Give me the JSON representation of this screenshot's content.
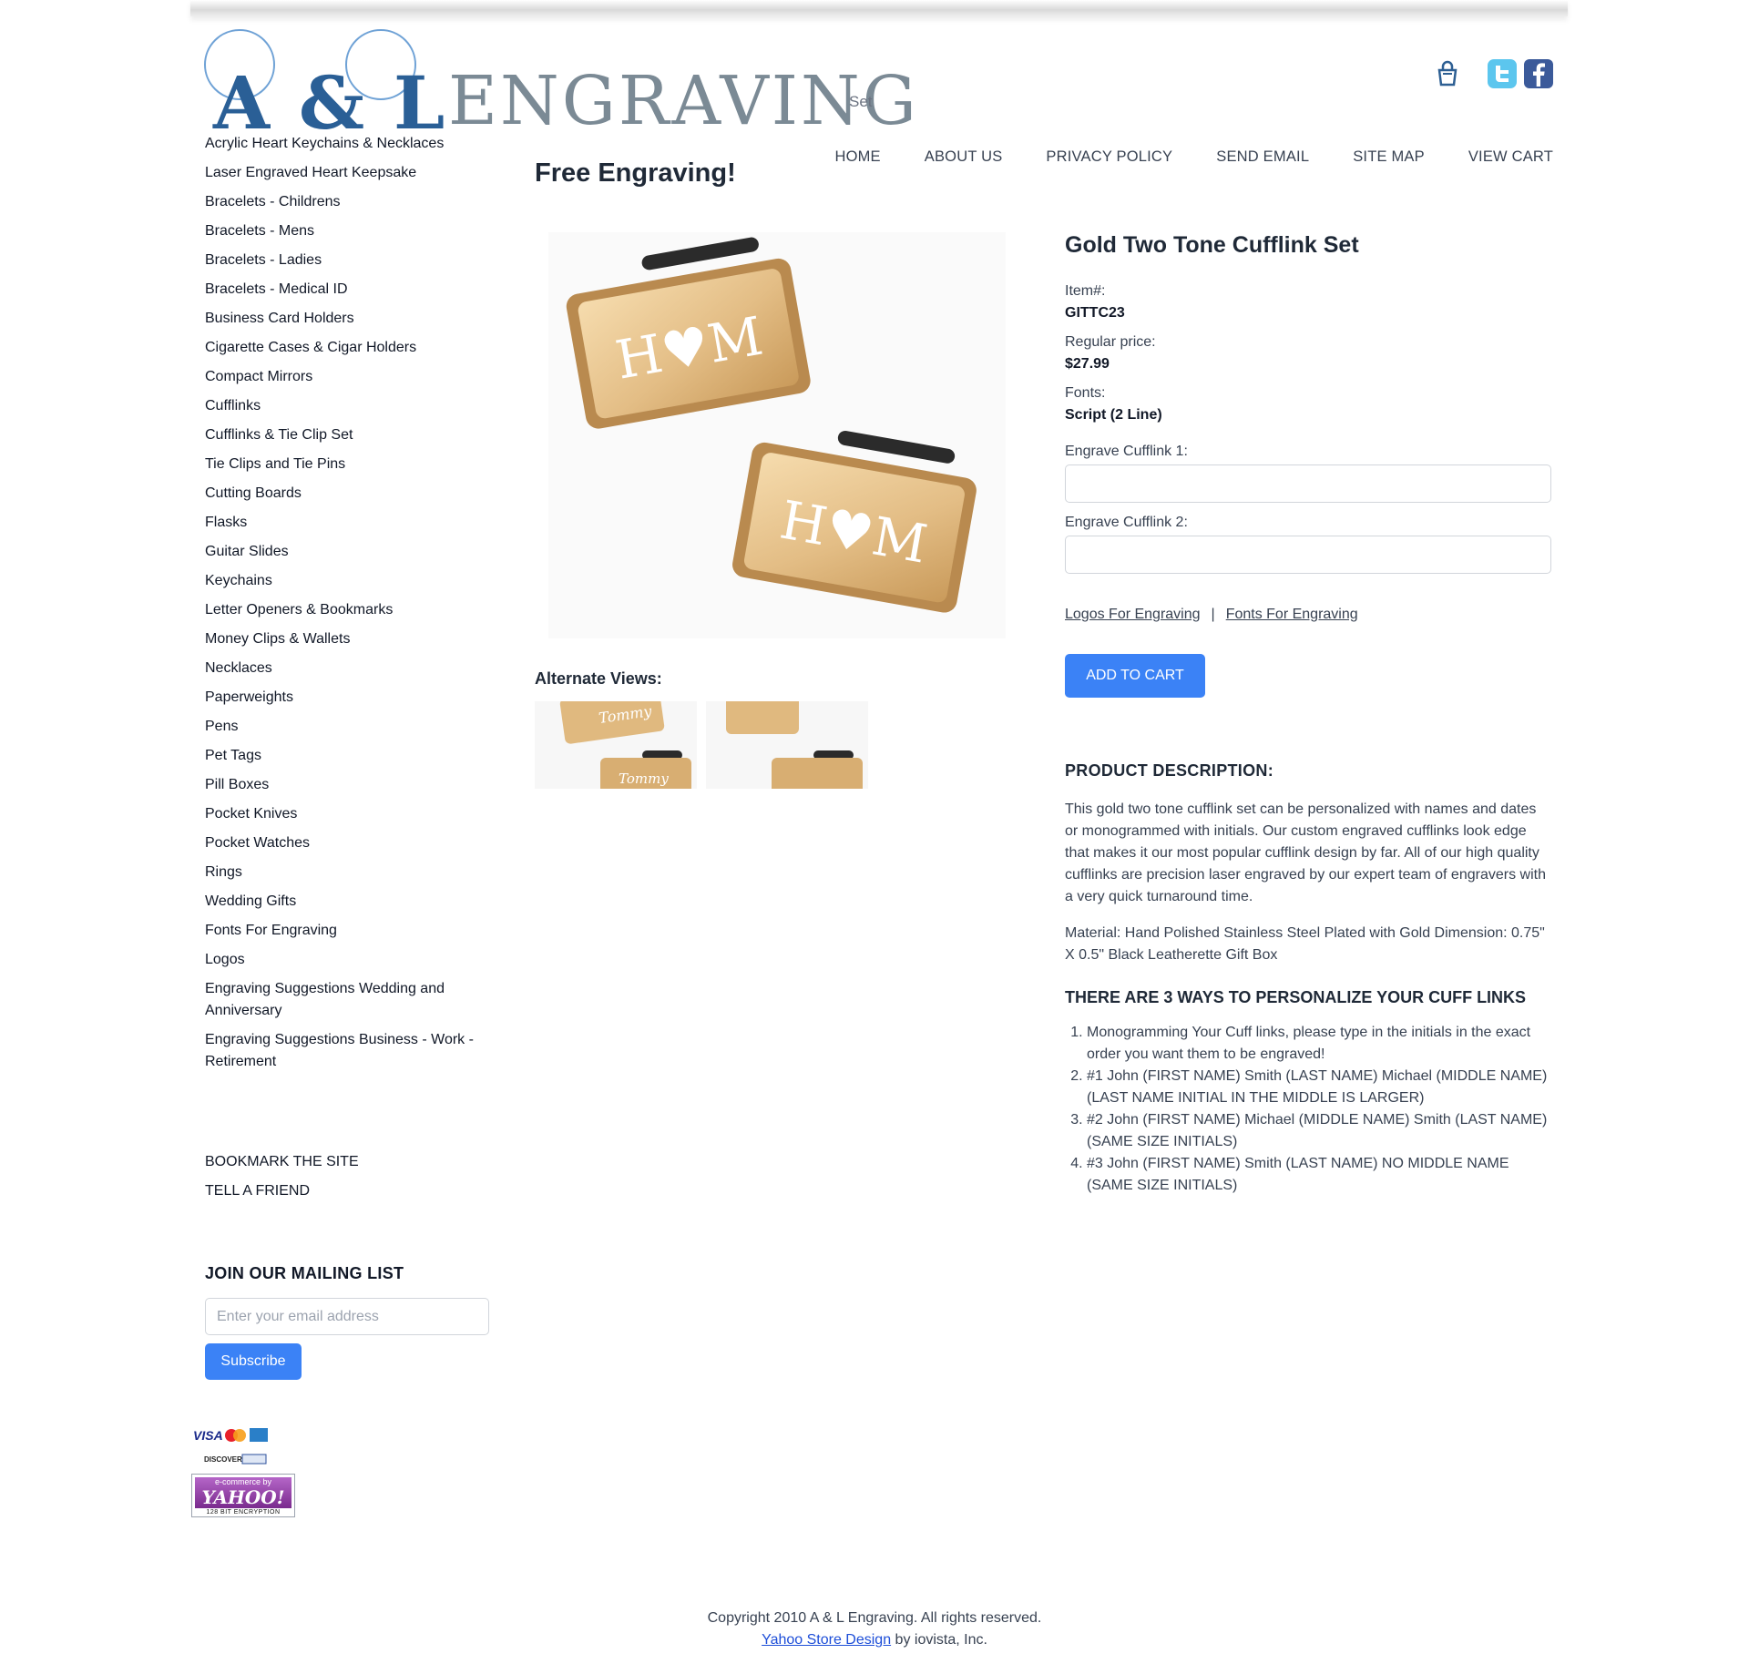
{
  "header": {
    "logo_letters": "A & L",
    "logo_word": "ENGRAVING",
    "logo_tag": "Set",
    "icons": [
      "shopping-bag-icon",
      "twitter-icon",
      "facebook-icon"
    ]
  },
  "nav": [
    "HOME",
    "ABOUT US",
    "PRIVACY POLICY",
    "SEND EMAIL",
    "SITE MAP",
    "VIEW CART"
  ],
  "promo": "Free Engraving!",
  "sidebar": {
    "categories": [
      "Acrylic Heart Keychains & Necklaces",
      "Laser Engraved Heart Keepsake",
      "Bracelets - Childrens",
      "Bracelets - Mens",
      "Bracelets - Ladies",
      "Bracelets - Medical ID",
      "Business Card Holders",
      "Cigarette Cases & Cigar Holders",
      "Compact Mirrors",
      "Cufflinks",
      "Cufflinks & Tie Clip Set",
      "Tie Clips and Tie Pins",
      "Cutting Boards",
      "Flasks",
      "Guitar Slides",
      "Keychains",
      "Letter Openers & Bookmarks",
      "Money Clips & Wallets",
      "Necklaces",
      "Paperweights",
      "Pens",
      "Pet Tags",
      "Pill Boxes",
      "Pocket Knives",
      "Pocket Watches",
      "Rings",
      "Wedding Gifts",
      "Fonts For Engraving",
      "Logos",
      "Engraving Suggestions Wedding and Anniversary",
      "Engraving Suggestions Business - Work - Retirement"
    ],
    "bookmark": "BOOKMARK THE SITE",
    "tell_friend": "TELL A FRIEND",
    "mailing_title": "JOIN OUR MAILING LIST",
    "email_placeholder": "Enter your email address",
    "subscribe": "Subscribe"
  },
  "badges": {
    "cards": [
      "VISA",
      "DISCOVER"
    ],
    "yahoo_top": "e-commerce by",
    "yahoo_name": "YAHOO!",
    "yahoo_bottom": "128 BIT ENCRYPTION"
  },
  "product": {
    "title": "Gold Two Tone Cufflink Set",
    "item_label": "Item#:",
    "item_value": "GITTC23",
    "price_label": "Regular price:",
    "price_value": "$27.99",
    "fonts_label": "Fonts:",
    "fonts_value": "Script (2 Line)",
    "engrave1_label": "Engrave Cufflink 1:",
    "engrave2_label": "Engrave Cufflink 2:",
    "logos_link": "Logos For Engraving",
    "fonts_link": "Fonts For Engraving",
    "separator": "|",
    "add_to_cart": "ADD TO CART",
    "monogram": "H♥M",
    "alt_views_title": "Alternate Views:",
    "thumb_text": "Tommy",
    "description_title": "PRODUCT DESCRIPTION:",
    "description": "This gold two tone cufflink set can be personalized with names and dates or monogrammed with initials. Our custom engraved cufflinks look edge that makes it our most popular cufflink design by far. All of our high quality cufflinks are precision laser engraved by our expert team of engravers with a very quick turnaround time.",
    "material": "Material: Hand Polished Stainless Steel Plated with Gold Dimension: 0.75\" X 0.5\" Black Leatherette Gift Box",
    "ways_title": "THERE ARE 3 WAYS TO PERSONALIZE YOUR CUFF LINKS",
    "ways": [
      "Monogramming Your Cuff links, please type in the initials in the exact order you want them to be engraved!",
      "#1 John (FIRST NAME) Smith (LAST NAME) Michael (MIDDLE NAME) (LAST NAME INITIAL IN THE MIDDLE IS LARGER)",
      "#2 John (FIRST NAME) Michael (MIDDLE NAME) Smith (LAST NAME) (SAME SIZE INITIALS)",
      "#3 John (FIRST NAME) Smith (LAST NAME) NO MIDDLE NAME (SAME SIZE INITIALS)"
    ]
  },
  "footer": {
    "copyright": "Copyright 2010 A & L Engraving. All rights reserved.",
    "design_link": "Yahoo Store Design",
    "design_suffix": " by iovista, Inc."
  },
  "colors": {
    "accent_button": "#3b82f6",
    "logo_blue": "#2a5f96",
    "logo_gray": "#7b8a95",
    "gold": "#e8c48c"
  }
}
